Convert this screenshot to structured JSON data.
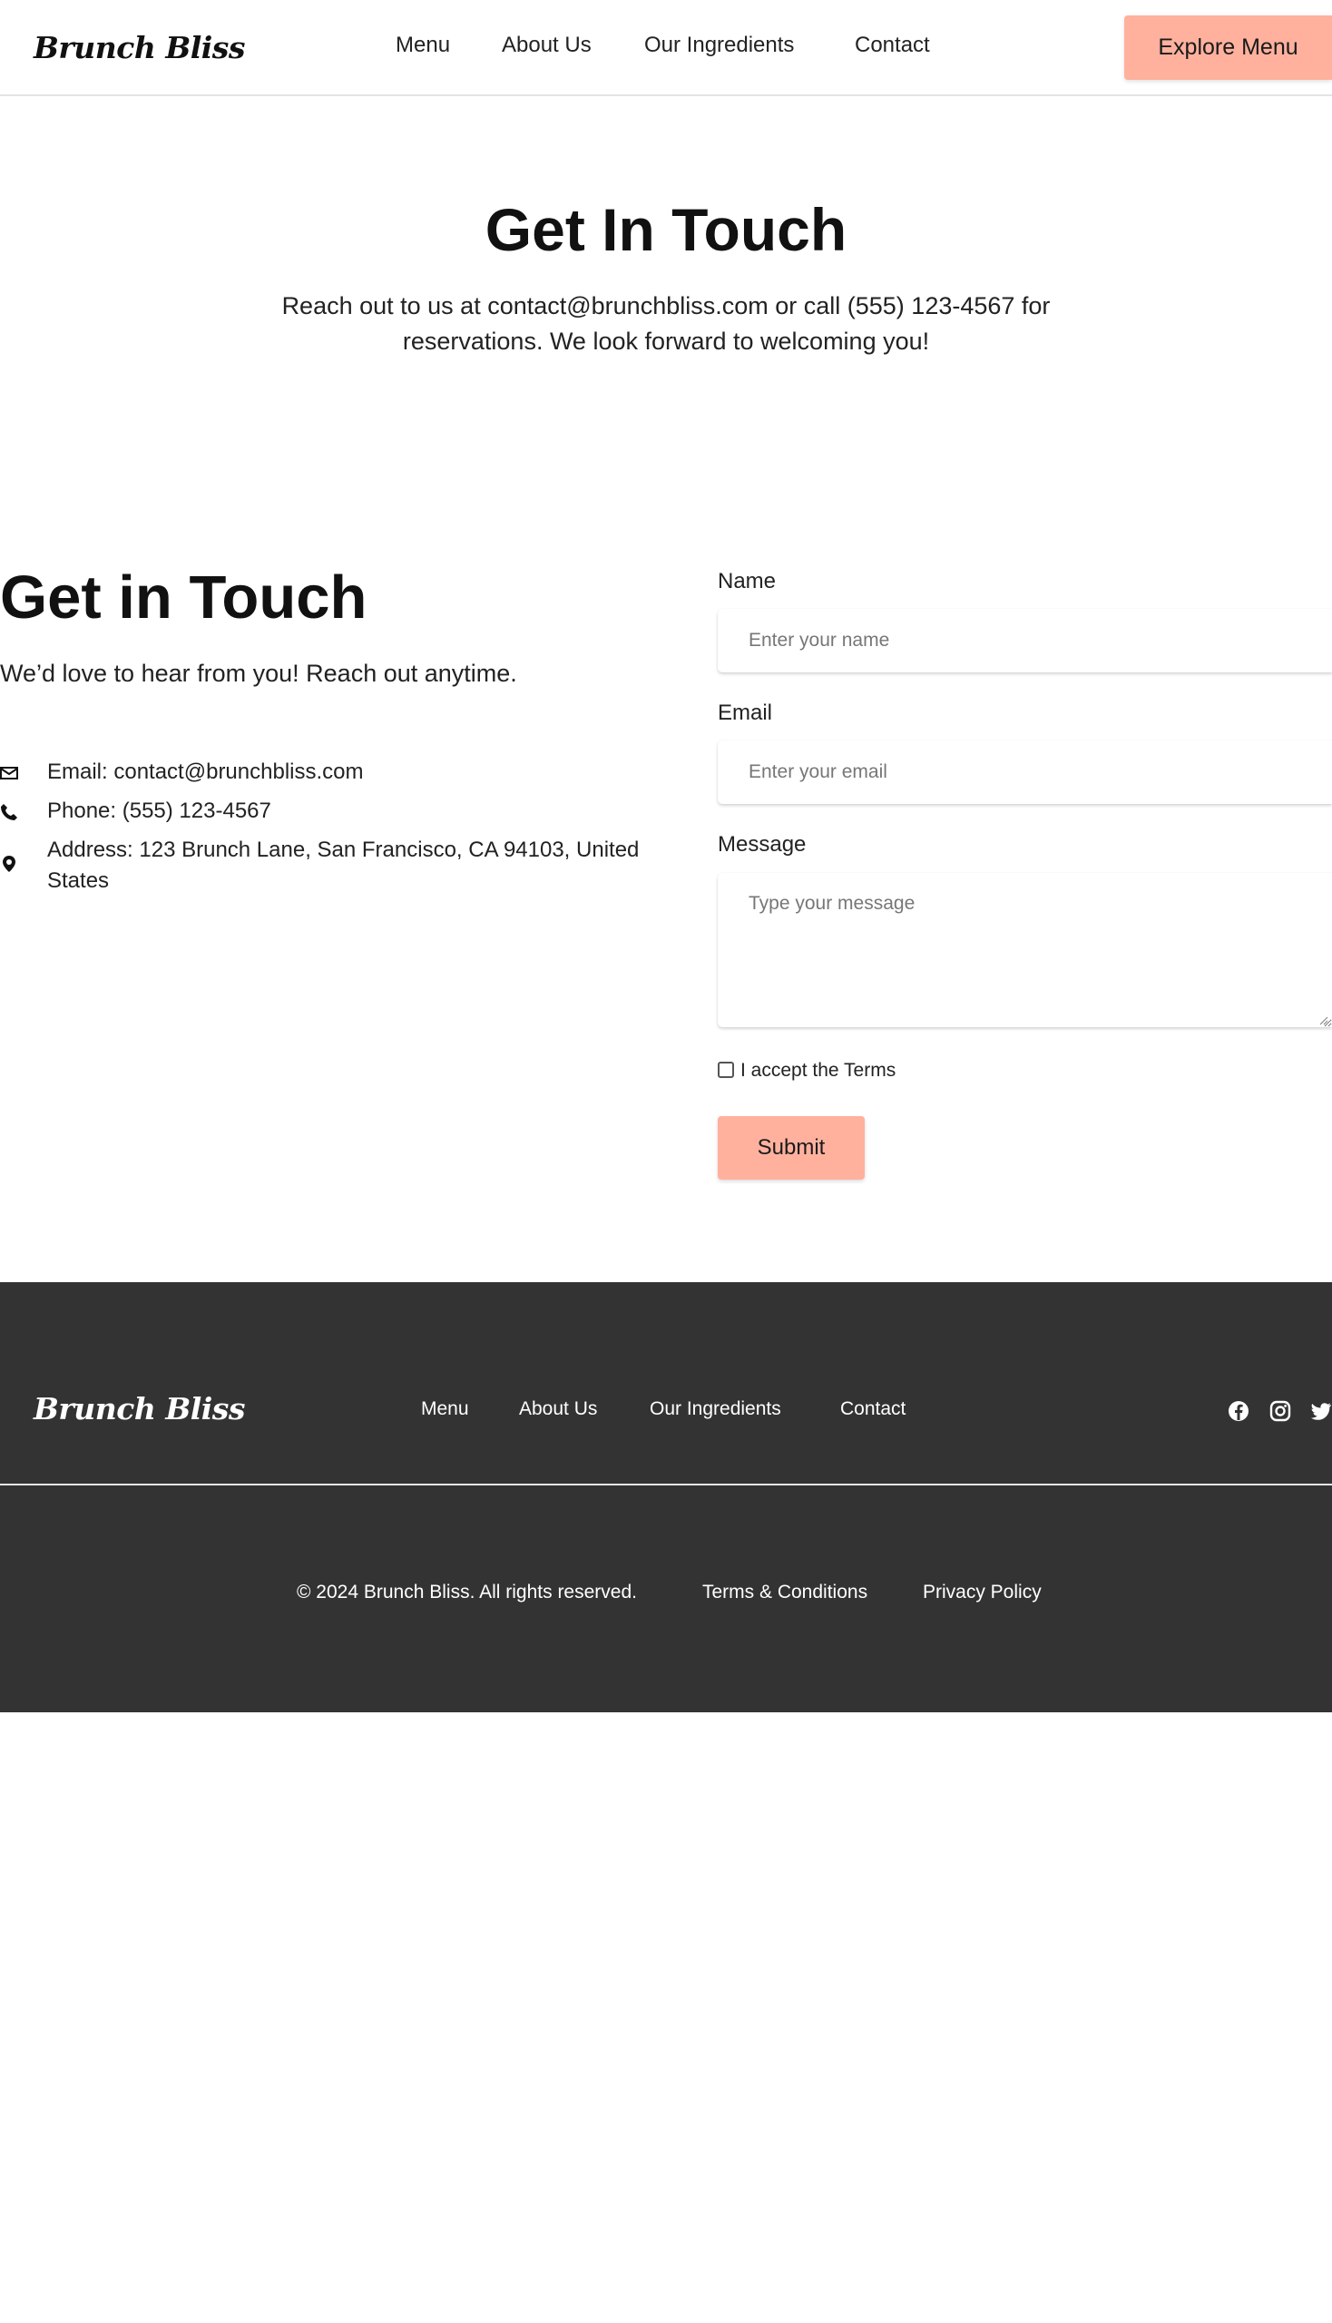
{
  "header": {
    "logo": "Brunch Bliss",
    "nav": [
      "Menu",
      "About Us",
      "Our Ingredients",
      "Contact"
    ],
    "cta": "Explore Menu"
  },
  "hero": {
    "title": "Get In Touch",
    "text": "Reach out to us at contact@brunchbliss.com or call (555) 123-4567 for reservations. We look forward to welcoming you!"
  },
  "contact": {
    "title": "Get in Touch",
    "subtitle": "We’d love to hear from you! Reach out anytime.",
    "email": "Email: contact@brunchbliss.com",
    "phone": "Phone: (555) 123-4567",
    "address": "Address: 123 Brunch Lane, San Francisco, CA 94103, United States",
    "icons": [
      "envelope-icon",
      "phone-icon",
      "map-pin-icon"
    ]
  },
  "form": {
    "name_label": "Name",
    "name_placeholder": "Enter your name",
    "email_label": "Email",
    "email_placeholder": "Enter your email",
    "message_label": "Message",
    "message_placeholder": "Type your message",
    "terms_label": "I accept the Terms",
    "terms_checked": false,
    "submit": "Submit"
  },
  "footer": {
    "logo": "Brunch Bliss",
    "nav": [
      "Menu",
      "About Us",
      "Our Ingredients",
      "Contact"
    ],
    "social": [
      "facebook-icon",
      "instagram-icon",
      "twitter-icon"
    ],
    "copyright": "© 2024 Brunch Bliss. All rights reserved.",
    "terms": "Terms & Conditions",
    "privacy": "Privacy Policy"
  },
  "colors": {
    "accent": "#ffb19e",
    "footer_bg": "#333333",
    "text": "#111111"
  }
}
